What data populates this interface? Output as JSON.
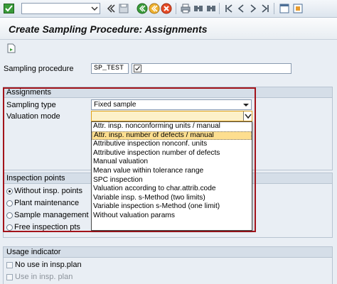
{
  "toolbar": {
    "command_value": "",
    "icons": [
      "enter-check-icon",
      "back-icon",
      "save-icon",
      "green-back-icon",
      "exit-icon",
      "cancel-icon",
      "print-icon",
      "find-icon",
      "find-next-icon",
      "first-page-icon",
      "previous-page-icon",
      "next-page-icon",
      "last-page-icon",
      "new-session-icon",
      "shortcut-icon"
    ]
  },
  "title": "Create Sampling Procedure: Assignments",
  "app_toolbar": {
    "icon": "execute-page-icon"
  },
  "sampling_procedure": {
    "label": "Sampling procedure",
    "value": "SP_TEST",
    "desc": ""
  },
  "assignments": {
    "header": "Assignments",
    "sampling_type_label": "Sampling type",
    "sampling_type_value": "Fixed sample",
    "valuation_mode_label": "Valuation mode",
    "valuation_mode_value": "",
    "options": [
      "Attr. insp. nonconforming units / manual",
      "Attr. insp. number of defects / manual",
      "Attributive inspection nonconf. units",
      "Attributive inspection number of defects",
      "Manual valuation",
      "Mean value within tolerance range",
      "SPC inspection",
      "Valuation according to char.attrib.code",
      "Variable insp. s-Method (two limits)",
      "Variable inspection s-Method (one limit)",
      "Without valuation params"
    ],
    "highlighted_option": "Attr. insp. number of defects / manual"
  },
  "inspection_points": {
    "header": "Inspection points",
    "options": [
      "Without insp. points",
      "Plant maintenance",
      "Sample management",
      "Free inspection pts"
    ],
    "selected": "Without insp. points"
  },
  "usage_indicator": {
    "header": "Usage indicator",
    "items": [
      "No use in insp.plan",
      "Use in insp. plan"
    ]
  },
  "colors": {
    "highlight": "#a3131a",
    "selection": "#fdde8f",
    "background": "#e9eef4"
  }
}
